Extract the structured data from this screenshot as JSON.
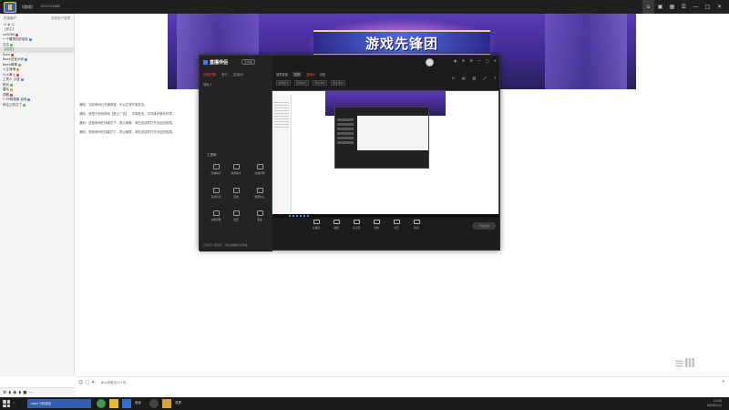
{
  "topbar": {
    "room_title": "《游戏》",
    "room_id": "1054702882",
    "icons": [
      "home-icon",
      "gamepad-icon",
      "grid-icon",
      "menu-icon",
      "minimize-icon",
      "maximize-icon",
      "close-icon"
    ]
  },
  "leftpanel": {
    "header_title": "在线用户",
    "manage_label": "查看用户管理",
    "users": [
      {
        "name": "【房主】",
        "type": "group"
      },
      {
        "name": "xx0085",
        "type": "user"
      },
      {
        "name": "一个暖男的好朋友",
        "type": "user"
      },
      {
        "name": "文文",
        "type": "user"
      },
      {
        "name": "【成员】",
        "type": "group",
        "selected": true
      },
      {
        "name": "Ezra",
        "type": "user"
      },
      {
        "name": "Bean法官大师",
        "type": "user"
      },
      {
        "name": "Bean棒棒",
        "type": "user"
      },
      {
        "name": "人生海海",
        "type": "user"
      },
      {
        "name": "小小黄土",
        "type": "user"
      },
      {
        "name": "工具人 小蓝",
        "type": "user"
      },
      {
        "name": "阳光",
        "type": "user"
      },
      {
        "name": "雷毛",
        "type": "user"
      },
      {
        "name": "洞察",
        "type": "user"
      },
      {
        "name": "T 99阿强像 游戏",
        "type": "user"
      },
      {
        "name": "风往上吹过了",
        "type": "user"
      }
    ]
  },
  "banner": {
    "title": "游戏先锋团"
  },
  "notices": [
    "通知：当前房间已开通语音，可以正常开麦发言。",
    "通知：请遵守房间规则【禁止广告】，文明发言，共同维护聊天环境。",
    "通知：语音房间在线模式下，禁止刷屏，请在说话时打开对应的权限。",
    "通知：语音房间在线模式下，禁止刷屏，请在说话时打开对应的权限。"
  ],
  "software": {
    "name": "直播伴侣",
    "version": "正式版",
    "left_tabs": [
      "场景切换",
      "素材",
      "直播间"
    ],
    "scene_label": "场景 1",
    "tools_title": "工具库",
    "tools": [
      "直播助手",
      "弹幕助手",
      "点播控制",
      "互动玩法",
      "连线",
      "数据中心",
      "直播录像",
      "设置",
      "更多"
    ],
    "footer": "已关闭 5 项功能，可在直播助手中开启。",
    "right_tabs": [
      "横屏直播",
      "竖屏",
      "直播间",
      "设置"
    ],
    "sub_tabs": [
      "横屏模式",
      "竖屏模式",
      "添加素材",
      "更多素材"
    ],
    "bottom_tools": [
      "直播间",
      "美颜",
      "麦克风",
      "音效",
      "音乐",
      "伴奏"
    ],
    "start_label": "开始直播"
  },
  "inputbar": {
    "placeholder": "和大家聊点什么吧..."
  },
  "taskbar": {
    "search_text": "caoil飞机梯控",
    "app_label": "媒体",
    "app2_label": "录屏",
    "time": "14:53",
    "date": "2023/11/1"
  },
  "colors": {
    "topbar_bg": "#1f1f1f",
    "accent_red": "#e84545",
    "accent_blue": "#3d7df0",
    "banner_purple": "#5a3bb8",
    "gold": "#f3d56c"
  }
}
